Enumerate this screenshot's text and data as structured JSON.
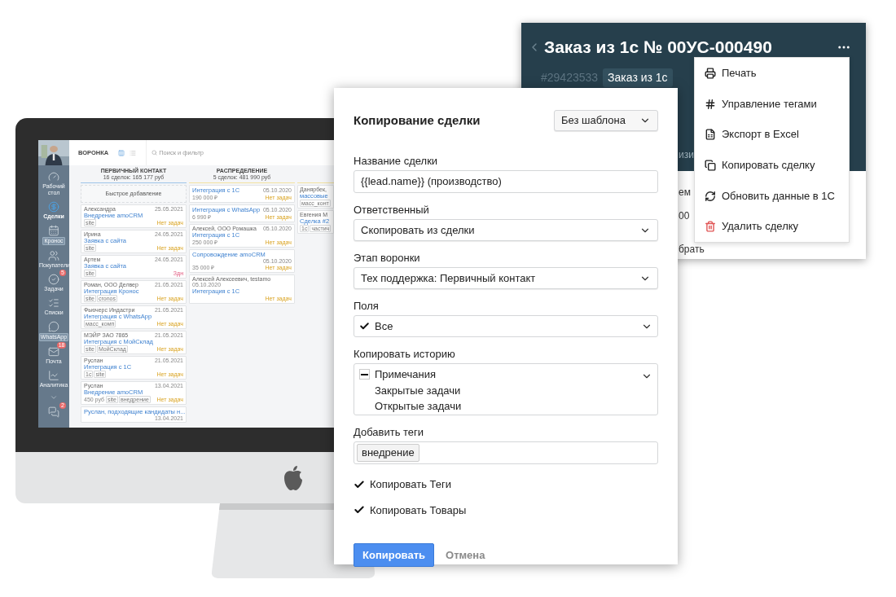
{
  "crm_screen": {
    "sidebar": {
      "items": [
        {
          "label": "Рабочий стол",
          "kind": "icon",
          "selected": false
        },
        {
          "label": "Сделки",
          "kind": "icon",
          "selected": true
        },
        {
          "label": "Кронос",
          "kind": "tag",
          "selected": false
        },
        {
          "label": "Покупатели",
          "kind": "icon",
          "selected": false
        },
        {
          "label": "Задачи",
          "kind": "icon",
          "selected": false,
          "badge": "5"
        },
        {
          "label": "Списки",
          "kind": "icon",
          "selected": false
        },
        {
          "label": "WhatsApp",
          "kind": "tag",
          "selected": false
        },
        {
          "label": "Почта",
          "kind": "icon",
          "selected": false,
          "badge": "18"
        },
        {
          "label": "Аналитика",
          "kind": "icon",
          "selected": false
        },
        {
          "kind": "more",
          "selected": false
        },
        {
          "kind": "icon",
          "selected": false,
          "badge": "2"
        }
      ]
    },
    "topbar": {
      "title": "ВОРОНКА",
      "search_placeholder": "Поиск и фильтр"
    },
    "columns": [
      {
        "title": "ПЕРВИЧНЫЙ КОНТАКТ",
        "summary": "16 сделок: 165 177 руб",
        "color": "#9ec5e8",
        "quick_add": "Быстрое добавление",
        "cards": [
          {
            "contact": "Александра",
            "date": "25.05.2021",
            "title": "Внедрение amoCRM",
            "tags": [
              "site"
            ],
            "status": "Нет задач",
            "overdue": false
          },
          {
            "contact": "Ирина",
            "date": "24.05.2021",
            "title": "Заявка с сайта",
            "tags": [
              "site"
            ],
            "status": "Нет задач",
            "overdue": false
          },
          {
            "contact": "Артем",
            "date": "24.05.2021",
            "title": "Заявка с сайта",
            "tags": [
              "site"
            ],
            "status": "Здн",
            "overdue": true
          },
          {
            "contact": "Роман, ООО Делвер",
            "date": "21.05.2021",
            "title": "Интеграция Кронос",
            "tags": [
              "site",
              "cronos"
            ],
            "status": "Нет задач",
            "overdue": false
          },
          {
            "contact": "Фьючерс Индастри",
            "date": "21.05.2021",
            "title": "Интеграция с WhatsApp",
            "tags": [
              "масс_комп"
            ],
            "status": "Нет задач",
            "overdue": false
          },
          {
            "contact": "МЭЙР ЗАО 7865",
            "date": "21.05.2021",
            "title": "Интеграция с МойСклад",
            "tags": [
              "site",
              "МойСклад"
            ],
            "status": "Нет задач",
            "overdue": false
          },
          {
            "contact": "Руслан",
            "date": "21.05.2021",
            "title": "Интеграция с 1С",
            "tags": [
              "1с",
              "site"
            ],
            "status": "Нет задач",
            "overdue": false
          },
          {
            "contact": "Руслан",
            "date": "13.04.2021",
            "title": "Внедрение amoCRM",
            "price": "450 руб",
            "tags": [
              "site",
              "внедрение"
            ],
            "status": "Нет задач",
            "overdue": false
          },
          {
            "title": "Руслан, подходящие кандидаты н...",
            "date": "13.04.2021"
          }
        ]
      },
      {
        "title": "РАСПРЕДЕЛЕНИЕ",
        "summary": "5 сделок: 481 990 руб",
        "color": "#f3e2a0",
        "cards": [
          {
            "date": "05.10.2020",
            "title": "Интеграция с 1С",
            "price": "190 000 ₽",
            "status": "Нет задач",
            "overdue": false
          },
          {
            "date": "05.10.2020",
            "title": "Интеграция с WhatsApp",
            "price": "6 990 ₽",
            "status": "Нет задач",
            "overdue": false
          },
          {
            "contact": "Алексей, ООО Ромашка",
            "date": "05.10.2020",
            "title": "Интеграция с 1С",
            "price": "250 000 ₽",
            "status": "Нет задач",
            "overdue": false
          },
          {
            "date": "05.10.2020",
            "title": "Сопровождение amoCRM",
            "price": "35 000 ₽",
            "status": "Нет задач",
            "overdue": false
          },
          {
            "contact": "Алексей Алексеевич, testamo",
            "date": "05.10.2020",
            "title": "Интеграция с 1С",
            "status": "Нет задач",
            "overdue": false
          }
        ]
      },
      {
        "color": "#f3e2a0",
        "cards": [
          {
            "contact": "Данярбек,",
            "title": "массовые",
            "tags": [
              "масс_конт"
            ]
          },
          {
            "contact": "Евгения М",
            "title": "Сделка #2",
            "tags": [
              "1с",
              "частич"
            ]
          }
        ]
      }
    ]
  },
  "deal": {
    "title": "Заказ из 1с № 00УС-000490",
    "id": "#29423533",
    "tag": "Заказ из 1с",
    "fragments": [
      {
        "text": "изи",
        "kind": "header"
      },
      {
        "text": "ем",
        "kind": "body"
      },
      {
        "text": "00",
        "kind": "body"
      },
      {
        "text": "брать",
        "kind": "body"
      }
    ]
  },
  "menu": {
    "items": [
      {
        "label": "Печать",
        "kind": "print"
      },
      {
        "label": "Управление тегами",
        "kind": "tags"
      },
      {
        "label": "Экспорт в Excel",
        "kind": "excel"
      },
      {
        "label": "Копировать сделку",
        "kind": "copy"
      },
      {
        "label": "Обновить данные в 1С",
        "kind": "sync"
      },
      {
        "label": "Удалить сделку",
        "kind": "delete"
      }
    ]
  },
  "dialog": {
    "title": "Копирование сделки",
    "template": "Без шаблона",
    "fields": [
      {
        "kind": "text",
        "label": "Название сделки",
        "value": "{{lead.name}} (производство)"
      },
      {
        "kind": "select",
        "label": "Ответственный",
        "value": "Скопировать из сделки"
      },
      {
        "kind": "select",
        "label": "Этап воронки",
        "value": "Тех поддержка: Первичный контакт"
      },
      {
        "kind": "check_select",
        "label": "Поля",
        "value": "Все",
        "checked": true
      },
      {
        "kind": "multi",
        "label": "Копировать историю",
        "options": [
          {
            "label": "Примечания",
            "indeterminate": true
          },
          {
            "label": "Закрытые задачи",
            "indeterminate": false
          },
          {
            "label": "Открытые задачи",
            "indeterminate": false
          }
        ]
      },
      {
        "kind": "tags",
        "label": "Добавить теги",
        "tags": [
          "внедрение"
        ]
      }
    ],
    "checks": [
      {
        "label": "Копировать Теги",
        "checked": true
      },
      {
        "label": "Копировать Товары",
        "checked": true
      }
    ],
    "buttons": [
      {
        "label": "Копировать",
        "kind": "primary"
      },
      {
        "label": "Отмена",
        "kind": "cancel"
      }
    ]
  }
}
